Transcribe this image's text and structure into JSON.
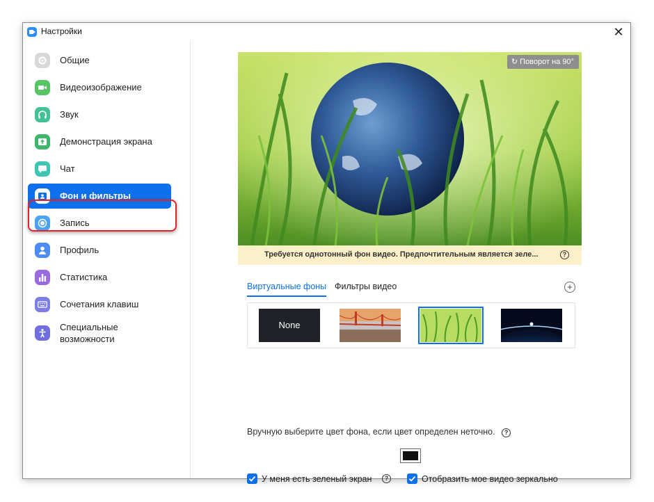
{
  "window": {
    "title": "Настройки",
    "close_glyph": "✕"
  },
  "sidebar": {
    "items": [
      {
        "label": "Общие",
        "icon": "gear-icon",
        "color": "#d8d8d8"
      },
      {
        "label": "Видеоизображение",
        "icon": "video-camera-icon",
        "color": "#58c463"
      },
      {
        "label": "Звук",
        "icon": "headphones-icon",
        "color": "#45c19a"
      },
      {
        "label": "Демонстрация экрана",
        "icon": "share-screen-icon",
        "color": "#3db86a"
      },
      {
        "label": "Чат",
        "icon": "chat-bubble-icon",
        "color": "#3fc5b4"
      },
      {
        "label": "Фон и фильтры",
        "icon": "background-icon",
        "color": "#ffffff"
      },
      {
        "label": "Запись",
        "icon": "record-icon",
        "color": "#4aa3f0"
      },
      {
        "label": "Профиль",
        "icon": "profile-icon",
        "color": "#4d8cf5"
      },
      {
        "label": "Статистика",
        "icon": "statistics-icon",
        "color": "#9a6ae0"
      },
      {
        "label": "Сочетания клавиш",
        "icon": "keyboard-icon",
        "color": "#7d7de6"
      },
      {
        "label": "Специальные\nвозможности",
        "icon": "accessibility-icon",
        "color": "#6f6fe0"
      }
    ],
    "active_index": 5
  },
  "preview": {
    "rotate_label": "Поворот на 90°"
  },
  "warning": {
    "text": "Требуется однотонный фон видео. Предпочтительным является зеле...",
    "help": "?"
  },
  "tabs": {
    "virtual": "Виртуальные фоны",
    "filters": "Фильтры видео",
    "add": "+"
  },
  "gallery": {
    "items": [
      {
        "label": "None",
        "kind": "none"
      },
      {
        "label": "",
        "kind": "golden-gate-bridge"
      },
      {
        "label": "",
        "kind": "grass"
      },
      {
        "label": "",
        "kind": "earth-from-space"
      }
    ],
    "selected_index": 2
  },
  "manual_color": {
    "text": "Вручную выберите цвет фона, если цвет определен неточно.",
    "help": "?",
    "color": "#111111"
  },
  "options": {
    "green_screen": {
      "label": "У меня есть зеленый экран",
      "checked": true,
      "help": "?"
    },
    "mirror": {
      "label": "Отобразить мое видео зеркально",
      "checked": true
    }
  },
  "accent": "#0e71eb"
}
